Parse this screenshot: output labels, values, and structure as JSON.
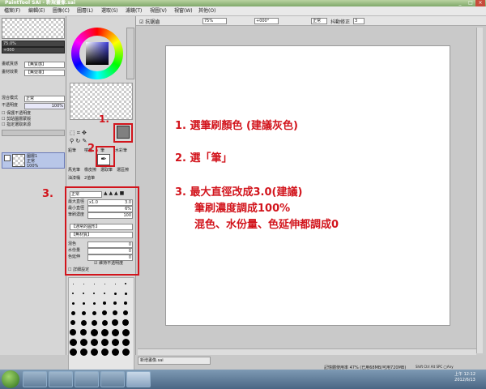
{
  "window": {
    "app_name": "PaintTool SAI",
    "title_suffix": "- 新規畫像.sai",
    "controls": [
      "_",
      "□",
      "×"
    ]
  },
  "menu": [
    {
      "label": "檔案(F)"
    },
    {
      "label": "編輯(E)"
    },
    {
      "label": "圖像(C)"
    },
    {
      "label": "圖層(L)"
    },
    {
      "label": "選取(S)"
    },
    {
      "label": "濾鏡(T)"
    },
    {
      "label": "視圖(V)"
    },
    {
      "label": "視窗(W)"
    },
    {
      "label": "其他(O)"
    }
  ],
  "canvas_toolbar": {
    "aa_label": "抗鋸齒",
    "zoom": "75%",
    "rotation": "+000°",
    "blend": "正常",
    "stabilizer_label": "抖動修正",
    "stabilizer_value": "3"
  },
  "left_panel": {
    "nav_zoom": "75.0%",
    "nav_angle": "+000",
    "paper_texture_label": "畫紙質感",
    "paper_texture_value": "【無質感】",
    "paper_effect_label": "畫材效果",
    "paper_effect_value": "【無效果】",
    "blend_mode_label": "混合模式",
    "blend_mode_value": "正常",
    "opacity_label": "不透明度",
    "opacity_value": "100%",
    "checkboxes": [
      "保護不透明度",
      "剪貼圖層蒙版",
      "指定選取來源"
    ],
    "layer_name": "圖層1",
    "layer_mode": "正常",
    "layer_opacity": "100%"
  },
  "tool_panel": {
    "tools_row1": [
      "鉛筆",
      "噴槍",
      "筆",
      "水彩筆"
    ],
    "tools_row2": [
      "馬克筆",
      "橡皮擦",
      "選取筆",
      "選區擦"
    ],
    "tools_row3": [
      "油漆桶",
      "2值筆"
    ],
    "brush_mode": "正常",
    "max_size_label": "最大直徑",
    "max_size_mult": "x1.0",
    "max_size_value": "3.0",
    "min_size_label": "最小直徑",
    "min_size_value": "6%",
    "density_label": "筆刷濃度",
    "density_value": "100",
    "shape_value": "【通常的圓形】",
    "texture_value": "【無材質】",
    "blend_label": "混色",
    "blend_value": "0",
    "water_label": "水份量",
    "water_value": "0",
    "stretch_label": "色延伸",
    "stretch_value": "0",
    "keep_opacity_label": "維持不透明度",
    "detail_label": "詳細設定"
  },
  "annotations": {
    "num1": "1.",
    "num2": "2.",
    "num3": "3.",
    "step1": "1. 選筆刷顏色 (建議灰色)",
    "step2": "2. 選「筆」",
    "step3_line1": "3. 最大直徑改成3.0(建議)",
    "step3_line2": "筆刷濃度調成100%",
    "step3_line3": "混色、水份量、色延伸都調成0"
  },
  "status": {
    "file_tab": "新增畫像.sai",
    "memory": "記憶體使用率 47% (已用68MB/可用720MB)",
    "indicators": "Shift Ctrl Alt SPC ◯Any",
    "time": "上午 12:12",
    "date": "2012/6/13"
  },
  "colors": {
    "accent_red": "#d2141c",
    "title_bar": "#8fb47a",
    "selected_brush_color": "#808080"
  }
}
